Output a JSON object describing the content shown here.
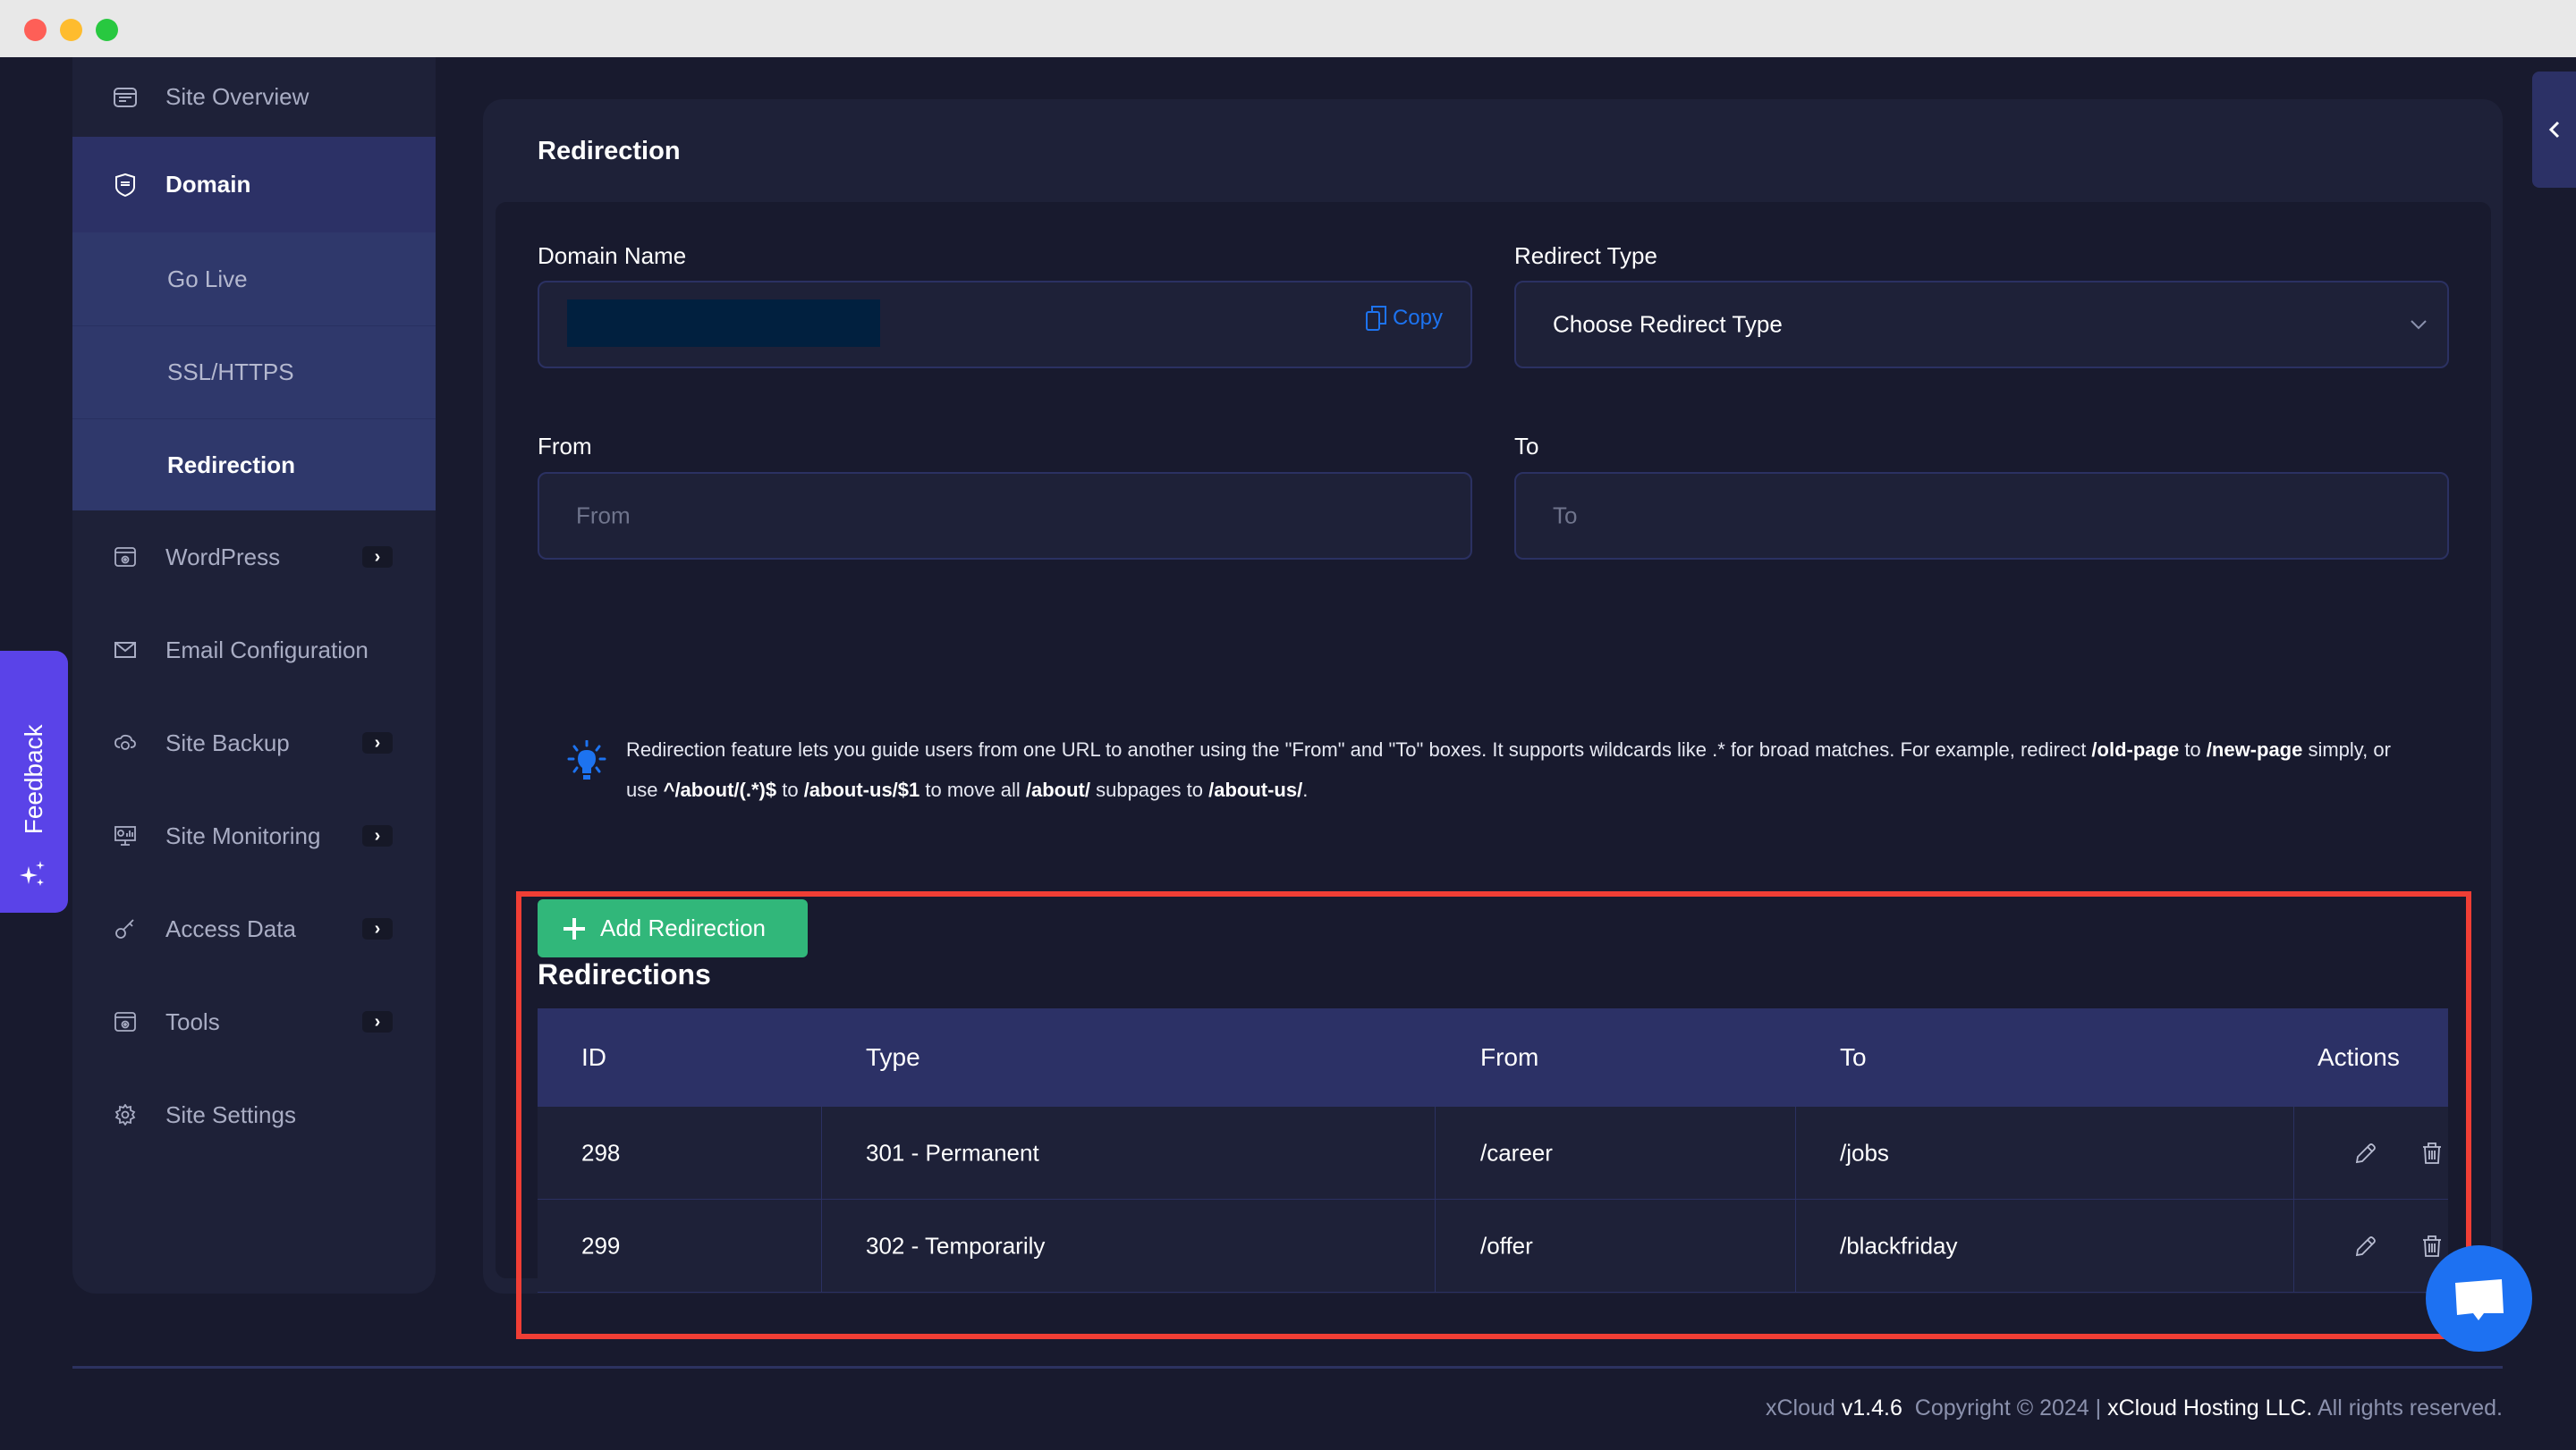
{
  "window": {
    "controls": [
      "close",
      "minimize",
      "maximize"
    ]
  },
  "sidebar": {
    "items": [
      {
        "label": "Site Overview",
        "icon": "browser-window-icon",
        "has_submenu": false
      },
      {
        "label": "Domain",
        "icon": "https-shield-icon",
        "active": true,
        "children": [
          {
            "label": "Go Live"
          },
          {
            "label": "SSL/HTTPS"
          },
          {
            "label": "Redirection",
            "current": true
          }
        ]
      },
      {
        "label": "WordPress",
        "icon": "wordpress-settings-icon",
        "has_submenu": true
      },
      {
        "label": "Email Configuration",
        "icon": "envelope-icon",
        "has_submenu": false
      },
      {
        "label": "Site Backup",
        "icon": "cloud-sync-icon",
        "has_submenu": true
      },
      {
        "label": "Site Monitoring",
        "icon": "monitor-chart-icon",
        "has_submenu": true
      },
      {
        "label": "Access Data",
        "icon": "key-icon",
        "has_submenu": true
      },
      {
        "label": "Tools",
        "icon": "tools-settings-icon",
        "has_submenu": true
      },
      {
        "label": "Site Settings",
        "icon": "gear-icon",
        "has_submenu": false
      }
    ]
  },
  "feedback": {
    "label": "Feedback"
  },
  "main": {
    "title": "Redirection",
    "form": {
      "domain_name": {
        "label": "Domain Name",
        "value": "",
        "copy_label": "Copy"
      },
      "redirect_type": {
        "label": "Redirect Type",
        "selected": "Choose Redirect Type"
      },
      "from": {
        "label": "From",
        "placeholder": "From",
        "value": ""
      },
      "to": {
        "label": "To",
        "placeholder": "To",
        "value": ""
      }
    },
    "info": {
      "segments": [
        {
          "text": "Redirection feature lets you guide users from one URL to another using the \"From\" and \"To\" boxes. It supports wildcards like .* for broad matches. For example, redirect ",
          "bold": false
        },
        {
          "text": "/old-page",
          "bold": true
        },
        {
          "text": " to ",
          "bold": false
        },
        {
          "text": "/new-page",
          "bold": true
        },
        {
          "text": " simply, or use ",
          "bold": false
        },
        {
          "text": "^/about/(.*)$",
          "bold": true
        },
        {
          "text": " to ",
          "bold": false
        },
        {
          "text": "/about-us/$1",
          "bold": true
        },
        {
          "text": " to move all ",
          "bold": false
        },
        {
          "text": "/about/",
          "bold": true
        },
        {
          "text": " subpages to ",
          "bold": false
        },
        {
          "text": "/about-us/",
          "bold": true
        },
        {
          "text": ".",
          "bold": false
        }
      ]
    },
    "add_button": "Add Redirection",
    "table": {
      "title": "Redirections",
      "columns": [
        "ID",
        "Type",
        "From",
        "To",
        "Actions"
      ],
      "rows": [
        {
          "id": "298",
          "type": "301 - Permanent",
          "from": "/career",
          "to": "/jobs"
        },
        {
          "id": "299",
          "type": "302 - Temporarily",
          "from": "/offer",
          "to": "/blackfriday"
        }
      ],
      "row_actions": [
        "edit",
        "delete"
      ]
    }
  },
  "footer": {
    "brand": "xCloud",
    "version": "v1.4.6",
    "copyright": "Copyright © 2024 |",
    "company": "xCloud Hosting LLC.",
    "rights": "All rights reserved."
  },
  "colors": {
    "accent_green": "#31b77a",
    "accent_blue": "#1d71f2",
    "feedback_purple": "#5a43e8",
    "highlight_red": "#f03e35",
    "active_nav": "#2c3166"
  }
}
